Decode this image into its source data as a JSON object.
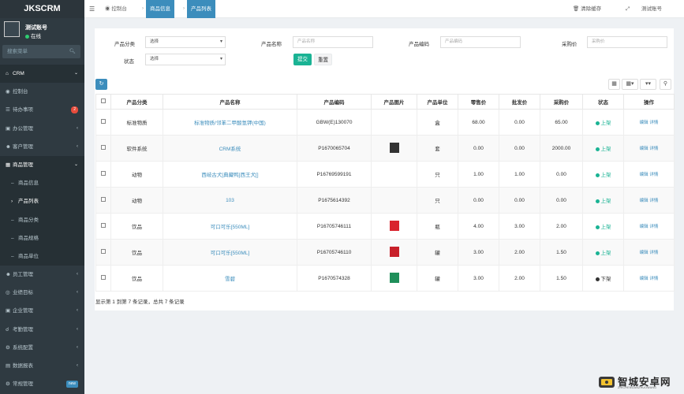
{
  "app": {
    "name": "JKSCRM"
  },
  "user": {
    "name": "测试账号",
    "status": "在线"
  },
  "sidebar_search": {
    "placeholder": "搜索菜单"
  },
  "menu": [
    {
      "label": "CRM",
      "icon": "home-icon",
      "open": true
    },
    {
      "label": "控制台",
      "icon": "dashboard-icon"
    },
    {
      "label": "待办事项",
      "icon": "todo-icon",
      "badge": "2"
    },
    {
      "label": "办公管理",
      "icon": "briefcase-icon"
    },
    {
      "label": "客户管理",
      "icon": "customer-icon"
    },
    {
      "label": "商品管理",
      "icon": "goods-icon",
      "open": true
    },
    {
      "label": "商品信息",
      "sub": true
    },
    {
      "label": "产品列表",
      "sub": true,
      "active": true
    },
    {
      "label": "商品分类",
      "sub": true
    },
    {
      "label": "商品规格",
      "sub": true
    },
    {
      "label": "商品单位",
      "sub": true
    },
    {
      "label": "员工管理",
      "icon": "staff-icon"
    },
    {
      "label": "业绩目标",
      "icon": "target-icon"
    },
    {
      "label": "企业管理",
      "icon": "enterprise-icon"
    },
    {
      "label": "考勤管理",
      "icon": "attendance-icon"
    },
    {
      "label": "系统配置",
      "icon": "gear-icon"
    },
    {
      "label": "数据报表",
      "icon": "report-icon"
    },
    {
      "label": "常规管理",
      "icon": "settings-icon",
      "badge": "new"
    }
  ],
  "topbar": {
    "tabs": [
      "控制台",
      "商品信息",
      "产品列表"
    ],
    "clear_cache": "清除缓存",
    "account": "测试账号"
  },
  "filters": {
    "category_label": "产品分类",
    "category_value": "选择",
    "name_label": "产品名称",
    "name_placeholder": "产品名称",
    "code_label": "产品编码",
    "code_placeholder": "产品编码",
    "price_label": "采购价",
    "price_placeholder": "采购价",
    "status_label": "状态",
    "status_value": "选择",
    "submit": "提交",
    "reset": "重置"
  },
  "table": {
    "headers": [
      "产品分类",
      "产品名称",
      "产品编码",
      "产品图片",
      "产品单位",
      "零售价",
      "批发价",
      "采购价",
      "状态",
      "操作"
    ],
    "rows": [
      {
        "category": "标准物质",
        "name": "标准物质/邻苯二甲酸氢钾(中国)",
        "code": "GBW(E)130070",
        "image": null,
        "unit": "盒",
        "retail": "68.00",
        "wholesale": "0.00",
        "purchase": "65.00",
        "status": "上架",
        "status_on": true
      },
      {
        "category": "软件系统",
        "name": "CRM系统",
        "code": "P1670065704",
        "image": "#333333",
        "unit": "套",
        "retail": "0.00",
        "wholesale": "0.00",
        "purchase": "2000.00",
        "status": "上架",
        "status_on": true
      },
      {
        "category": "动物",
        "name": "西岐古犬[典藏鸭]西王犬[]",
        "code": "P1676959919​1",
        "image": null,
        "unit": "只",
        "retail": "1.00",
        "wholesale": "1.00",
        "purchase": "0.00",
        "status": "上架",
        "status_on": true
      },
      {
        "category": "动物",
        "name": "103",
        "code": "P1675614392",
        "image": null,
        "unit": "只",
        "retail": "0.00",
        "wholesale": "0.00",
        "purchase": "0.00",
        "status": "上架",
        "status_on": true
      },
      {
        "category": "饮品",
        "name": "可口可乐[550ML]",
        "code": "P1670574611​1",
        "image": "#d9232d",
        "unit": "瓶",
        "retail": "4.00",
        "wholesale": "3.00",
        "purchase": "2.00",
        "status": "上架",
        "status_on": true
      },
      {
        "category": "饮品",
        "name": "可口可乐[550ML]",
        "code": "P1670574611​0",
        "image": "#c8202a",
        "unit": "罐",
        "retail": "3.00",
        "wholesale": "2.00",
        "purchase": "1.50",
        "status": "上架",
        "status_on": true
      },
      {
        "category": "饮品",
        "name": "雪碧",
        "code": "P1670574328",
        "image": "#1f8f5a",
        "unit": "罐",
        "retail": "3.00",
        "wholesale": "2.00",
        "purchase": "1.50",
        "status": "下架",
        "status_on": false
      }
    ],
    "ops": {
      "edit": "编辑",
      "detail": "详情"
    }
  },
  "pagination": {
    "text": "显示第 1 到第 7 条记录，总共 7 条记录"
  },
  "watermark": {
    "text": "智城安卓网",
    "sub": "ZHICHENGANZHUOWANG"
  }
}
